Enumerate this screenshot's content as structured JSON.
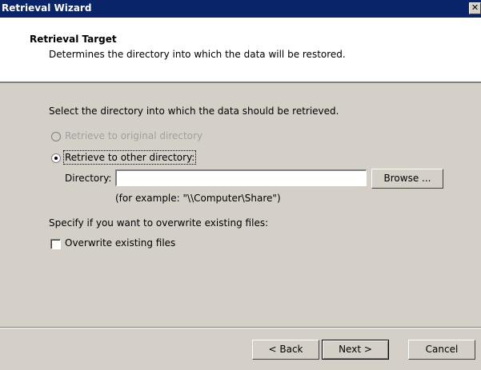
{
  "window": {
    "title": "Retrieval Wizard",
    "close_glyph": "✕"
  },
  "header": {
    "title": "Retrieval Target",
    "subtitle": "Determines the directory into which the data will be restored."
  },
  "body": {
    "instruction": "Select the directory into which the data should be retrieved.",
    "radio_original": {
      "label": "Retrieve to original directory",
      "enabled": false,
      "selected": false
    },
    "radio_other": {
      "label": "Retrieve to other directory:",
      "enabled": true,
      "selected": true
    },
    "directory_label": "Directory:",
    "directory_value": "",
    "browse_label": "Browse ...",
    "example_text": "(for example: \"\\\\Computer\\Share\")",
    "overwrite_prompt": "Specify if you want to overwrite existing files:",
    "overwrite_checkbox": {
      "label": "Overwrite existing files",
      "checked": false
    }
  },
  "footer": {
    "back_label": "< Back",
    "next_label": "Next >",
    "cancel_label": "Cancel"
  },
  "colors": {
    "titlebar": "#0a246a",
    "dialog_bg": "#d4d0c8",
    "disabled_text": "#a0a0a0"
  }
}
